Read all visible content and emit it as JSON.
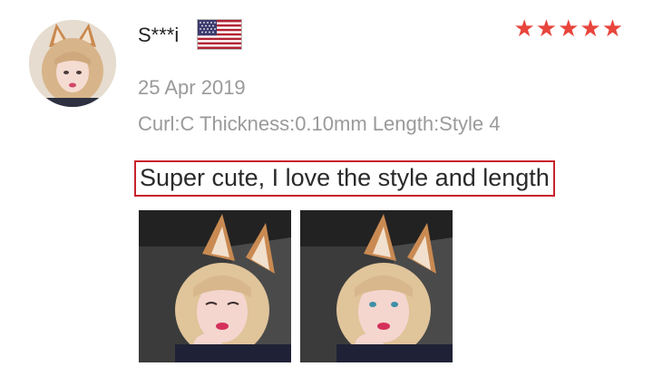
{
  "review": {
    "reviewer_name": "S***i",
    "country_flag": "us-flag-icon",
    "rating": 5,
    "rating_display": "★★★★★",
    "date": "25 Apr 2019",
    "sku": "Curl:C Thickness:0.10mm Length:Style 4",
    "comment": "Super cute, I love the style and length"
  },
  "colors": {
    "star": "#e8453c",
    "highlight_border": "#c8232c",
    "meta_text": "#9a9a9a"
  }
}
